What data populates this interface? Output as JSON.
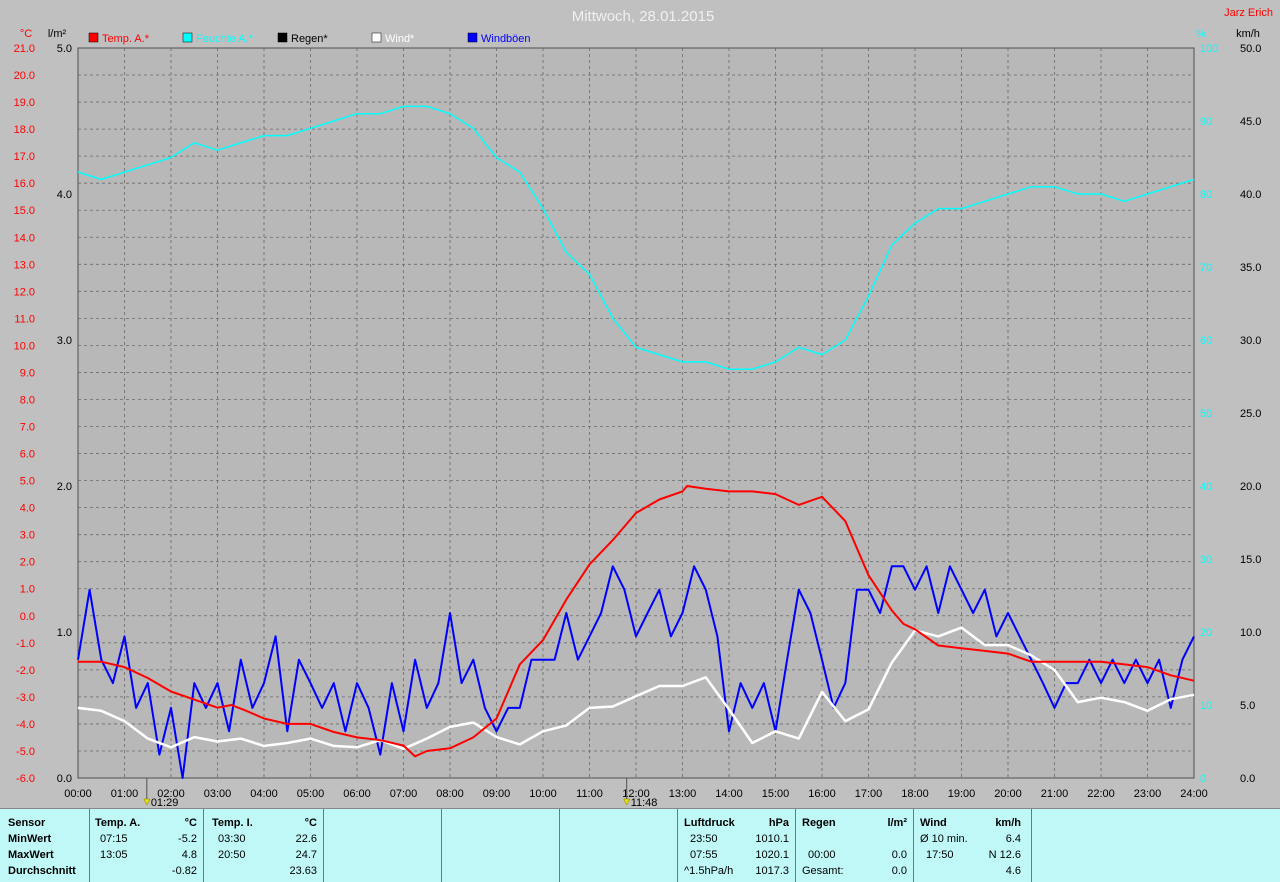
{
  "chart_data": {
    "type": "line",
    "title": "Mittwoch, 28.01.2015",
    "author": "Jarz Erich",
    "x_ticks": [
      "00:00",
      "01:00",
      "02:00",
      "03:00",
      "04:00",
      "05:00",
      "06:00",
      "07:00",
      "08:00",
      "09:00",
      "10:00",
      "11:00",
      "12:00",
      "13:00",
      "14:00",
      "15:00",
      "16:00",
      "17:00",
      "18:00",
      "19:00",
      "20:00",
      "21:00",
      "22:00",
      "23:00",
      "24:00"
    ],
    "axes": {
      "temp": {
        "unit": "°C",
        "ylim": [
          -6,
          21
        ],
        "ticks": [
          "21.0",
          "20.0",
          "19.0",
          "18.0",
          "17.0",
          "16.0",
          "15.0",
          "14.0",
          "13.0",
          "12.0",
          "11.0",
          "10.0",
          "9.0",
          "8.0",
          "7.0",
          "6.0",
          "5.0",
          "4.0",
          "3.0",
          "2.0",
          "1.0",
          "0.0",
          "-1.0",
          "-2.0",
          "-3.0",
          "-4.0",
          "-5.0",
          "-6.0"
        ],
        "color": "#ff0000"
      },
      "rain": {
        "unit": "l/m²",
        "ylim": [
          0,
          5
        ],
        "ticks": [
          "5.0",
          "4.0",
          "3.0",
          "2.0",
          "1.0",
          "0.0"
        ],
        "color": "#000000"
      },
      "humidity": {
        "unit": "%",
        "ylim": [
          0,
          100
        ],
        "ticks": [
          "100",
          "90",
          "80",
          "70",
          "60",
          "50",
          "40",
          "30",
          "20",
          "10",
          "0"
        ],
        "color": "#00ffff"
      },
      "wind": {
        "unit": "km/h",
        "ylim": [
          0,
          50
        ],
        "ticks": [
          "50.0",
          "45.0",
          "40.0",
          "35.0",
          "30.0",
          "25.0",
          "20.0",
          "15.0",
          "10.0",
          "5.0",
          "0.0"
        ],
        "color": "#000000"
      }
    },
    "legend": [
      {
        "name": "Temp. A.*",
        "color": "#ff0000"
      },
      {
        "name": "Feuchte A.*",
        "color": "#00ffff"
      },
      {
        "name": "Regen*",
        "color": "#000000"
      },
      {
        "name": "Wind*",
        "color": "#ffffff"
      },
      {
        "name": "Windböen",
        "color": "#0000ff"
      }
    ],
    "markers": [
      {
        "time": "01:29",
        "pos_h": 1.48
      },
      {
        "time": "11:48",
        "pos_h": 11.8
      }
    ],
    "series": [
      {
        "name": "Temp. A.*",
        "axis": "temp",
        "color": "#ff0000",
        "x": [
          0,
          0.5,
          1,
          1.5,
          2,
          2.5,
          3,
          3.3,
          3.6,
          4,
          4.5,
          5,
          5.5,
          6,
          6.5,
          7,
          7.25,
          7.5,
          8,
          8.5,
          9,
          9.5,
          10,
          10.5,
          11,
          11.5,
          12,
          12.5,
          13,
          13.1,
          13.5,
          14,
          14.5,
          15,
          15.5,
          16,
          16.5,
          17,
          17.5,
          17.75,
          18,
          18.5,
          19,
          19.5,
          20,
          20.5,
          21,
          21.5,
          22,
          22.5,
          23,
          23.5,
          24
        ],
        "values": [
          -1.7,
          -1.7,
          -1.9,
          -2.3,
          -2.8,
          -3.1,
          -3.4,
          -3.3,
          -3.5,
          -3.8,
          -4,
          -4,
          -4.3,
          -4.5,
          -4.6,
          -4.8,
          -5.2,
          -5.0,
          -4.9,
          -4.5,
          -3.8,
          -1.8,
          -0.9,
          0.6,
          1.9,
          2.8,
          3.8,
          4.3,
          4.6,
          4.8,
          4.7,
          4.6,
          4.6,
          4.5,
          4.1,
          4.4,
          3.5,
          1.5,
          0.2,
          -0.3,
          -0.5,
          -1.1,
          -1.2,
          -1.3,
          -1.4,
          -1.7,
          -1.7,
          -1.7,
          -1.7,
          -1.8,
          -1.9,
          -2.2,
          -2.4
        ]
      },
      {
        "name": "Feuchte A.*",
        "axis": "humidity",
        "color": "#00ffff",
        "x": [
          0,
          0.5,
          1,
          1.5,
          2,
          2.5,
          3,
          3.5,
          4,
          4.5,
          5,
          5.5,
          6,
          6.5,
          7,
          7.5,
          8,
          8.5,
          9,
          9.5,
          10,
          10.5,
          11,
          11.5,
          12,
          12.5,
          13,
          13.5,
          14,
          14.5,
          15,
          15.5,
          16,
          16.5,
          17,
          17.5,
          18,
          18.5,
          19,
          19.5,
          20,
          20.5,
          21,
          21.5,
          22,
          22.5,
          23,
          23.5,
          24
        ],
        "values": [
          83,
          82,
          83,
          84,
          85,
          87,
          86,
          87,
          88,
          88,
          89,
          90,
          91,
          91,
          92,
          92,
          91,
          89,
          85,
          83,
          78,
          72,
          69,
          63,
          59,
          58,
          57,
          57,
          56,
          56,
          57,
          59,
          58,
          60,
          66,
          73,
          76,
          78,
          78,
          79,
          80,
          81,
          81,
          80,
          80,
          79,
          80,
          81,
          82
        ]
      },
      {
        "name": "Wind*",
        "axis": "wind",
        "color": "#ffffff",
        "x": [
          0,
          0.5,
          1,
          1.5,
          2,
          2.5,
          3,
          3.5,
          4,
          4.5,
          5,
          5.5,
          6,
          6.5,
          7,
          7.5,
          8,
          8.5,
          9,
          9.5,
          10,
          10.5,
          11,
          11.5,
          12,
          12.5,
          13,
          13.5,
          14,
          14.5,
          15,
          15.5,
          16,
          16.5,
          17,
          17.5,
          18,
          18.5,
          19,
          19.5,
          20,
          20.5,
          21,
          21.5,
          22,
          22.5,
          23,
          23.5,
          24
        ],
        "values": [
          4.8,
          4.6,
          3.9,
          2.7,
          2.1,
          2.8,
          2.5,
          2.7,
          2.2,
          2.4,
          2.7,
          2.2,
          2.1,
          2.6,
          2.0,
          2.7,
          3.5,
          3.8,
          2.8,
          2.3,
          3.2,
          3.6,
          4.8,
          4.9,
          5.6,
          6.3,
          6.3,
          6.9,
          4.7,
          2.4,
          3.2,
          2.7,
          5.9,
          3.9,
          4.7,
          7.9,
          10.1,
          9.7,
          10.3,
          9.1,
          9.1,
          8.4,
          7.4,
          5.2,
          5.5,
          5.2,
          4.6,
          5.4,
          5.7
        ]
      },
      {
        "name": "Windböen",
        "axis": "wind",
        "color": "#0000ff",
        "x": [
          0,
          0.25,
          0.5,
          0.75,
          1,
          1.25,
          1.5,
          1.75,
          2,
          2.25,
          2.5,
          2.75,
          3,
          3.25,
          3.5,
          3.75,
          4,
          4.25,
          4.5,
          4.75,
          5,
          5.25,
          5.5,
          5.75,
          6,
          6.25,
          6.5,
          6.75,
          7,
          7.25,
          7.5,
          7.75,
          8,
          8.25,
          8.5,
          8.75,
          9,
          9.25,
          9.5,
          9.75,
          10,
          10.25,
          10.5,
          10.75,
          11,
          11.25,
          11.5,
          11.75,
          12,
          12.25,
          12.5,
          12.75,
          13,
          13.25,
          13.5,
          13.75,
          14,
          14.25,
          14.5,
          14.75,
          15,
          15.25,
          15.5,
          15.75,
          16,
          16.25,
          16.5,
          16.75,
          17,
          17.25,
          17.5,
          17.75,
          18,
          18.25,
          18.5,
          18.75,
          19,
          19.25,
          19.5,
          19.75,
          20,
          20.25,
          20.5,
          20.75,
          21,
          21.25,
          21.5,
          21.75,
          22,
          22.25,
          22.5,
          22.75,
          23,
          23.25,
          23.5,
          23.75,
          24
        ],
        "values": [
          8.1,
          12.9,
          8.1,
          6.5,
          9.7,
          4.8,
          6.5,
          1.6,
          4.8,
          0,
          6.5,
          4.8,
          6.5,
          3.2,
          8.1,
          4.8,
          6.5,
          9.7,
          3.2,
          8.1,
          6.5,
          4.8,
          6.5,
          3.2,
          6.5,
          4.8,
          1.6,
          6.5,
          3.2,
          8.1,
          4.8,
          6.5,
          11.3,
          6.5,
          8.1,
          4.8,
          3.2,
          4.8,
          4.8,
          8.1,
          8.1,
          8.1,
          11.3,
          8.1,
          9.7,
          11.3,
          14.5,
          12.9,
          9.7,
          11.3,
          12.9,
          9.7,
          11.3,
          14.5,
          12.9,
          9.7,
          3.2,
          6.5,
          4.8,
          6.5,
          3.2,
          8.1,
          12.9,
          11.3,
          8.1,
          4.8,
          6.5,
          12.9,
          12.9,
          11.3,
          14.5,
          14.5,
          12.9,
          14.5,
          11.3,
          14.5,
          12.9,
          11.3,
          12.9,
          9.7,
          11.3,
          9.7,
          8.1,
          6.5,
          4.8,
          6.5,
          6.5,
          8.1,
          6.5,
          8.1,
          6.5,
          8.1,
          6.5,
          8.1,
          4.8,
          8.1,
          9.7
        ]
      }
    ]
  },
  "table": {
    "sensor": {
      "header": "Sensor",
      "rows": [
        "MinWert",
        "MaxWert",
        "Durchschnitt"
      ]
    },
    "temp_a": {
      "header": "Temp. A.",
      "unit": "°C",
      "rows": [
        [
          "07:15",
          "-5.2"
        ],
        [
          "13:05",
          "4.8"
        ],
        [
          "",
          "-0.82"
        ]
      ]
    },
    "temp_i": {
      "header": "Temp. I.",
      "unit": "°C",
      "rows": [
        [
          "03:30",
          "22.6"
        ],
        [
          "20:50",
          "24.7"
        ],
        [
          "",
          "23.63"
        ]
      ]
    },
    "pressure": {
      "header": "Luftdruck",
      "unit": "hPa",
      "rows": [
        [
          "23:50",
          "1010.1"
        ],
        [
          "07:55",
          "1020.1"
        ],
        [
          "^1.5hPa/h",
          "1017.3"
        ]
      ]
    },
    "rain": {
      "header": "Regen",
      "unit": "l/m²",
      "rows": [
        [
          "",
          ""
        ],
        [
          "00:00",
          "0.0"
        ],
        [
          "Gesamt:",
          "0.0"
        ]
      ]
    },
    "wind": {
      "header": "Wind",
      "unit": "km/h",
      "rows": [
        [
          "Ø 10 min.",
          "6.4"
        ],
        [
          "17:50",
          "N 12.6"
        ],
        [
          "",
          "4.6"
        ]
      ]
    }
  }
}
